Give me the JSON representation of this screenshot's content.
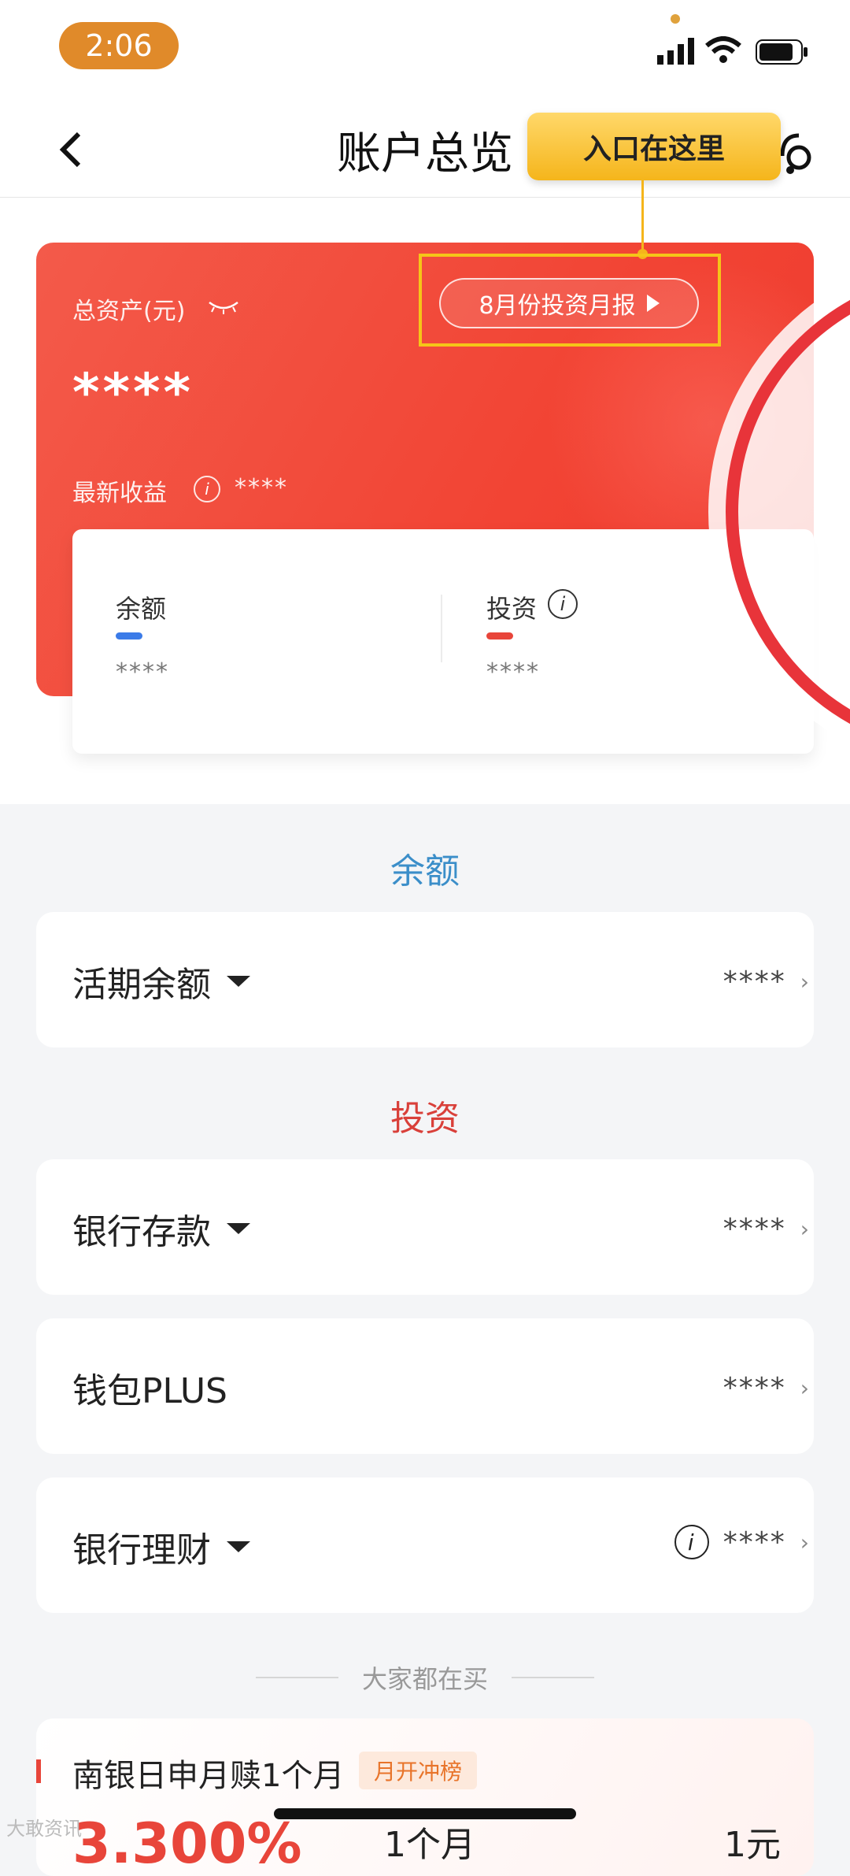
{
  "status_bar": {
    "time": "2:06"
  },
  "header": {
    "title": "账户总览",
    "back_icon": "chevron-left-icon",
    "service_icon": "headset-icon"
  },
  "callout": {
    "text": "入口在这里"
  },
  "asset_card": {
    "total_label": "总资产(元)",
    "report_button": "8月份投资月报",
    "total_value": "****",
    "yield_label": "最新收益",
    "yield_value": "****",
    "balance_label": "余额",
    "balance_value": "****",
    "investment_label": "投资",
    "investment_value": "****",
    "colors": {
      "card": "#f24434",
      "balance_bar": "#3b7be8",
      "investment_bar": "#e8453a"
    }
  },
  "sections": {
    "balance": {
      "title": "余额",
      "items": [
        {
          "label": "活期余额",
          "value": "****"
        }
      ]
    },
    "investment": {
      "title": "投资",
      "items": [
        {
          "label": "银行存款",
          "value": "****"
        },
        {
          "label": "钱包PLUS",
          "value": "****"
        },
        {
          "label": "银行理财",
          "value": "****"
        }
      ]
    }
  },
  "everyone_buy": {
    "title": "大家都在买"
  },
  "product": {
    "name": "南银日申月赎1个月",
    "tag": "月开冲榜",
    "rate": "3.300%",
    "term": "1个月",
    "min": "1元"
  },
  "watermark": "大敢资讯"
}
